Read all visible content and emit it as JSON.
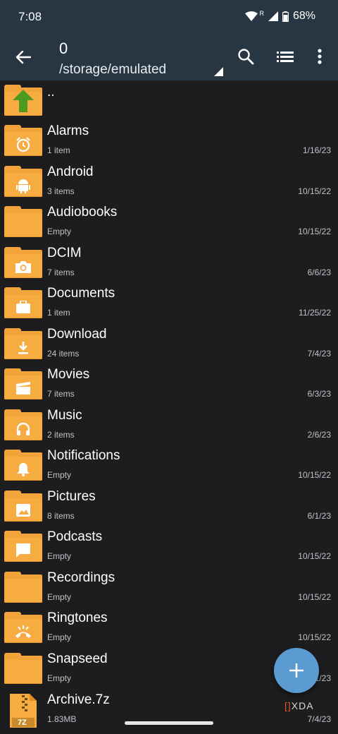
{
  "status": {
    "time": "7:08",
    "battery": "68%",
    "roaming": "R"
  },
  "appbar": {
    "title": "0",
    "path": "/storage/emulated"
  },
  "parent": {
    "label": ".."
  },
  "folders": [
    {
      "name": "Alarms",
      "sub": "1 item",
      "date": "1/16/23",
      "icon": "alarm-icon"
    },
    {
      "name": "Android",
      "sub": "3 items",
      "date": "10/15/22",
      "icon": "android-icon"
    },
    {
      "name": "Audiobooks",
      "sub": "Empty",
      "date": "10/15/22",
      "icon": ""
    },
    {
      "name": "DCIM",
      "sub": "7 items",
      "date": "6/6/23",
      "icon": "camera-icon"
    },
    {
      "name": "Documents",
      "sub": "1 item",
      "date": "11/25/22",
      "icon": "briefcase-icon"
    },
    {
      "name": "Download",
      "sub": "24 items",
      "date": "7/4/23",
      "icon": "download-icon"
    },
    {
      "name": "Movies",
      "sub": "7 items",
      "date": "6/3/23",
      "icon": "clapperboard-icon"
    },
    {
      "name": "Music",
      "sub": "2 items",
      "date": "2/6/23",
      "icon": "headphones-icon"
    },
    {
      "name": "Notifications",
      "sub": "Empty",
      "date": "10/15/22",
      "icon": "bell-icon"
    },
    {
      "name": "Pictures",
      "sub": "8 items",
      "date": "6/1/23",
      "icon": "image-icon"
    },
    {
      "name": "Podcasts",
      "sub": "Empty",
      "date": "10/15/22",
      "icon": "chat-icon"
    },
    {
      "name": "Recordings",
      "sub": "Empty",
      "date": "10/15/22",
      "icon": ""
    },
    {
      "name": "Ringtones",
      "sub": "Empty",
      "date": "10/15/22",
      "icon": "ringing-phone-icon"
    },
    {
      "name": "Snapseed",
      "sub": "Empty",
      "date": "1/23",
      "icon": ""
    }
  ],
  "archive": {
    "name": "Archive.7z",
    "sub": "1.83MB",
    "date": "7/4/23",
    "badge": "7Z"
  },
  "watermark": {
    "bracket": "[]",
    "text": "XDA"
  },
  "colors": {
    "appbar": "#273642",
    "background": "#1d1d1f",
    "folder": "#f7ac42",
    "fab": "#5b9bd1"
  }
}
